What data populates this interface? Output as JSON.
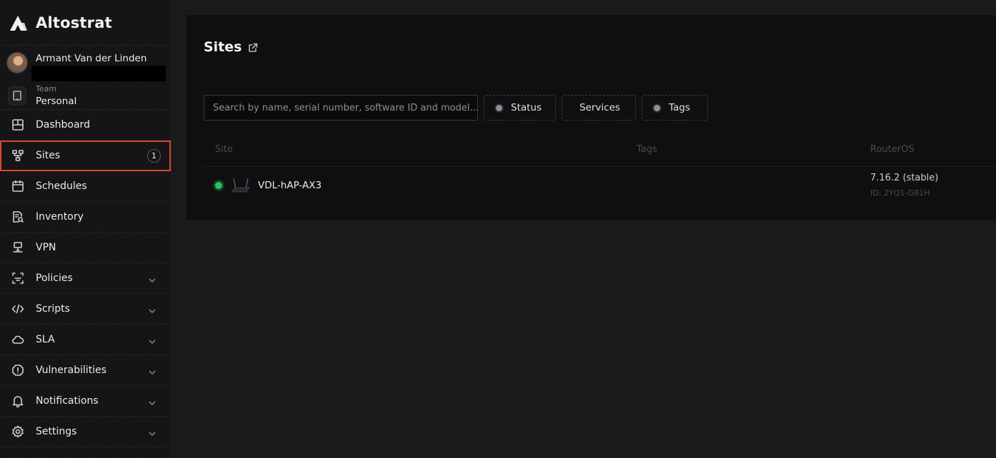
{
  "app": {
    "brand": "Altostrat"
  },
  "user": {
    "name": "Armant Van der Linden"
  },
  "team": {
    "label": "Team",
    "value": "Personal"
  },
  "sidebar": {
    "items": [
      {
        "label": "Dashboard",
        "icon": "dashboard-icon"
      },
      {
        "label": "Sites",
        "icon": "sites-icon",
        "badge": "1",
        "active": true
      },
      {
        "label": "Schedules",
        "icon": "calendar-icon"
      },
      {
        "label": "Inventory",
        "icon": "inventory-icon"
      },
      {
        "label": "VPN",
        "icon": "vpn-icon"
      },
      {
        "label": "Policies",
        "icon": "policies-icon",
        "expandable": true
      },
      {
        "label": "Scripts",
        "icon": "code-icon",
        "expandable": true
      },
      {
        "label": "SLA",
        "icon": "cloud-icon",
        "expandable": true
      },
      {
        "label": "Vulnerabilities",
        "icon": "alert-icon",
        "expandable": true
      },
      {
        "label": "Notifications",
        "icon": "bell-icon",
        "expandable": true
      },
      {
        "label": "Settings",
        "icon": "gear-icon",
        "expandable": true
      }
    ]
  },
  "main": {
    "title": "Sites",
    "search": {
      "placeholder": "Search by name, serial number, software ID and model...",
      "value": ""
    },
    "filters": {
      "status": "Status",
      "services": "Services",
      "tags": "Tags"
    },
    "table": {
      "headers": [
        "Site",
        "Tags",
        "RouterOS"
      ],
      "rows": [
        {
          "status": "online",
          "name": "VDL-hAP-AX3",
          "tags": "",
          "routeros": "7.16.2 (stable)",
          "id": "ID: 2YQ1-G81H"
        }
      ]
    }
  },
  "colors": {
    "accent_highlight": "#d9472e",
    "status_online": "#22c55e"
  }
}
